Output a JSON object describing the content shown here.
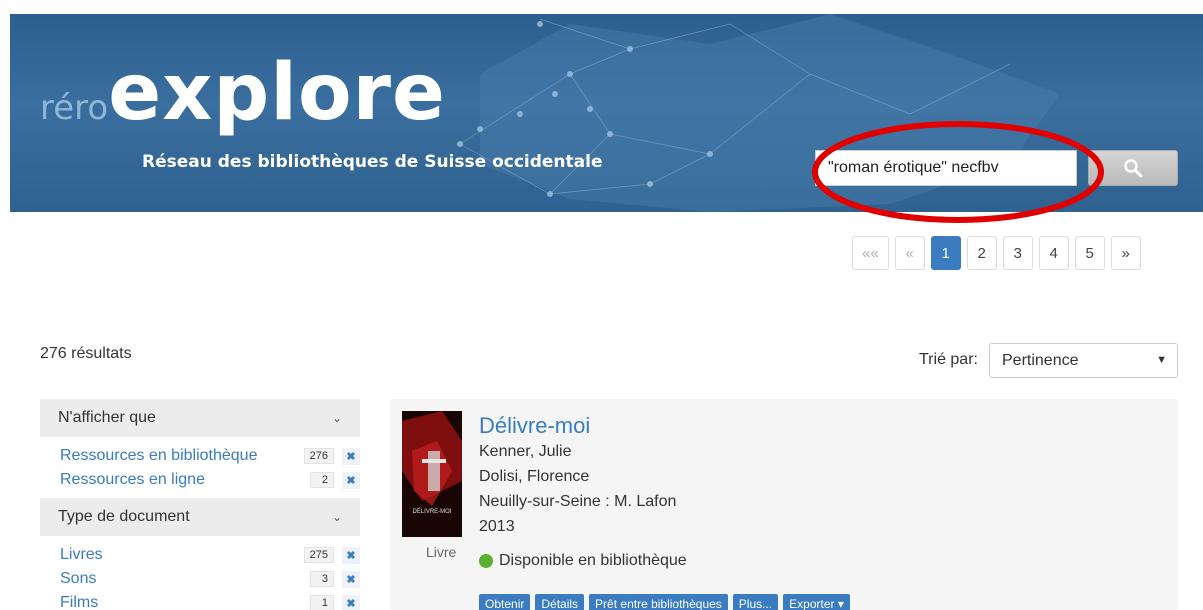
{
  "header": {
    "logo_prefix": "réro",
    "logo_main": "explore",
    "subtitle": "Réseau des bibliothèques de Suisse occidentale",
    "search_value": "\"roman érotique\" necfbv"
  },
  "pagination": {
    "first": "««",
    "prev": "«",
    "pages": [
      "1",
      "2",
      "3",
      "4",
      "5"
    ],
    "next": "»",
    "current": "1"
  },
  "results": {
    "count_text": "276 résultats",
    "sort_label": "Trié par:",
    "sort_value": "Pertinence"
  },
  "facets": [
    {
      "title": "N'afficher que",
      "items": [
        {
          "label": "Ressources en bibliothèque",
          "count": "276"
        },
        {
          "label": "Ressources en ligne",
          "count": "2"
        }
      ]
    },
    {
      "title": "Type de document",
      "items": [
        {
          "label": "Livres",
          "count": "275"
        },
        {
          "label": "Sons",
          "count": "3"
        },
        {
          "label": "Films",
          "count": "1"
        }
      ]
    }
  ],
  "record": {
    "title": "Délivre-moi",
    "author1": "Kenner, Julie",
    "author2": "Dolisi, Florence",
    "publisher": "Neuilly-sur-Seine : M. Lafon",
    "year": "2013",
    "doctype": "Livre",
    "availability": "Disponible en bibliothèque",
    "cover_text": "DÉLIVRE-MOI",
    "actions": [
      "Obtenir",
      "Détails",
      "Prêt entre bibliothèques",
      "Plus...",
      "Exporter ▾"
    ]
  },
  "colors": {
    "banner": "#2f6290",
    "accent": "#3a7cbf",
    "available": "#5bb12f",
    "annotation": "#e00000"
  }
}
